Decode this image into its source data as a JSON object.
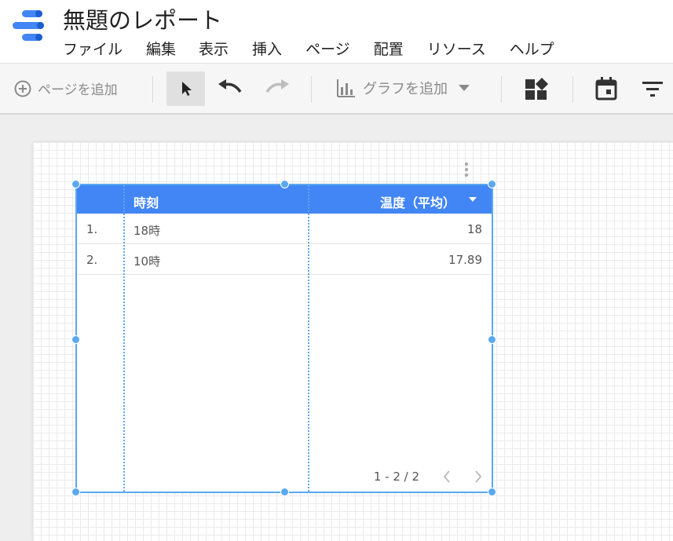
{
  "app": {
    "title": "無題のレポート"
  },
  "menu": {
    "items": [
      "ファイル",
      "編集",
      "表示",
      "挿入",
      "ページ",
      "配置",
      "リソース",
      "ヘルプ"
    ]
  },
  "toolbar": {
    "add_page_label": "ページを追加",
    "add_chart_label": "グラフを追加"
  },
  "icons": [
    "logo-icon",
    "add-circle-icon",
    "cursor-icon",
    "undo-icon",
    "redo-icon",
    "bar-chart-icon",
    "caret-down-icon",
    "components-icon",
    "calendar-icon",
    "filter-icon",
    "more-vert-icon",
    "chevron-left-icon",
    "chevron-right-icon"
  ],
  "colors": {
    "header_blue": "#4285f4",
    "selection": "#5aa9f0"
  },
  "table": {
    "columns": [
      "時刻",
      "温度（平均）"
    ],
    "rows": [
      {
        "index": "1.",
        "time": "18時",
        "temp": "18"
      },
      {
        "index": "2.",
        "time": "10時",
        "temp": "17.89"
      }
    ],
    "pagination": "1 - 2 / 2"
  }
}
